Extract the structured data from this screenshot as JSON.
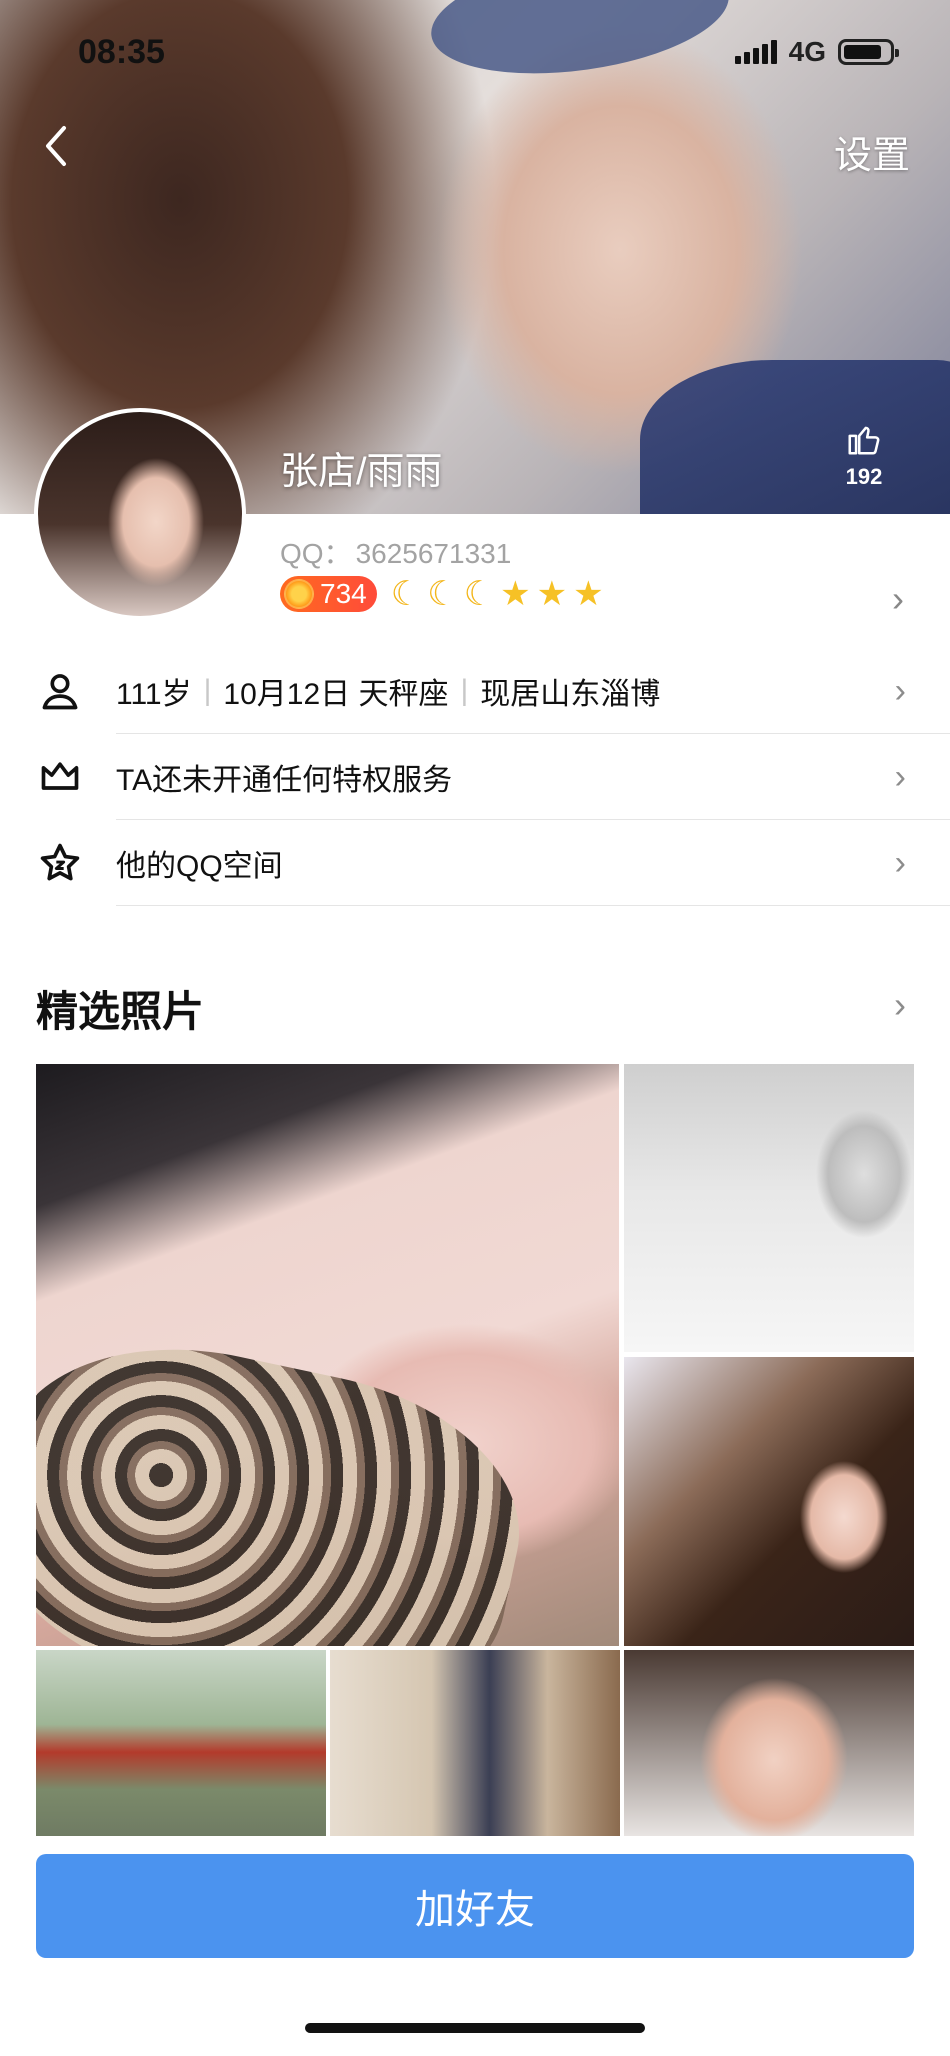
{
  "status_bar": {
    "time": "08:35",
    "network": "4G",
    "battery_level": 0.85
  },
  "header": {
    "settings_label": "设置",
    "nickname": "张店/雨雨",
    "like_count": "192"
  },
  "profile": {
    "qq_label": "QQ：",
    "qq_number": "3625671331",
    "level_value": "734",
    "level_icons": [
      "moon-icon",
      "moon-icon",
      "moon-icon",
      "star-icon",
      "star-icon",
      "star-icon"
    ]
  },
  "info_rows": {
    "age": "111岁",
    "birthday": "10月12日 天秤座",
    "location": "现居山东淄博",
    "privilege": "TA还未开通任何特权服务",
    "qzone": "他的QQ空间"
  },
  "photos": {
    "section_title": "精选照片"
  },
  "actions": {
    "add_friend": "加好友"
  },
  "colors": {
    "accent": "#4b93ef",
    "level_badge": "#ff5a2c",
    "moon_star": "#f3b61b"
  }
}
